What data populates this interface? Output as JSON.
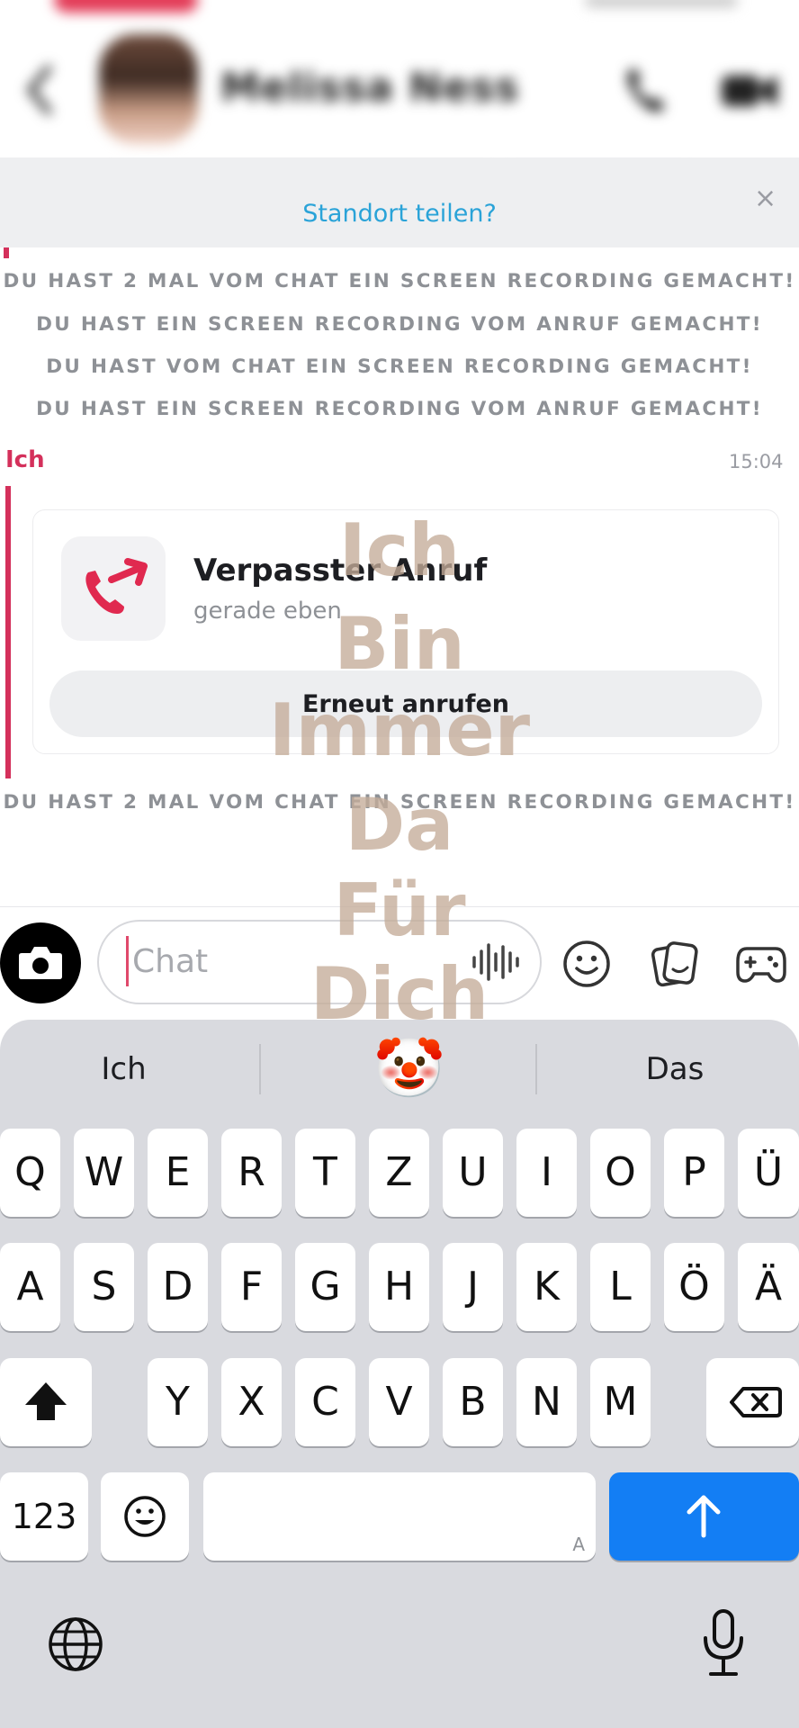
{
  "header": {
    "contact_name": "Melissa Ness",
    "info_text_blurred": "",
    "location_prompt": "Standort teilen?",
    "close_glyph": "×"
  },
  "messages": {
    "system_top": [
      "DU HAST 2 MAL VOM CHAT EIN SCREEN RECORDING GEMACHT!",
      "DU HAST EIN SCREEN RECORDING VOM ANRUF GEMACHT!",
      "DU HAST VOM CHAT EIN SCREEN RECORDING GEMACHT!",
      "DU HAST EIN SCREEN RECORDING VOM ANRUF GEMACHT!"
    ],
    "sender": "Ich",
    "time": "15:04",
    "call_card": {
      "title": "Verpasster Anruf",
      "subtitle": "gerade eben",
      "button_label": "Erneut anrufen"
    },
    "system_bottom": "DU HAST 2 MAL VOM CHAT EIN SCREEN RECORDING GEMACHT!"
  },
  "watermark_lines": [
    "Ich",
    "Bin",
    "Immer",
    "Da",
    "Für",
    "Dich"
  ],
  "input": {
    "placeholder": "Chat"
  },
  "keyboard": {
    "suggestions": [
      "Ich",
      "🤡",
      "Das"
    ],
    "row1": [
      "Q",
      "W",
      "E",
      "R",
      "T",
      "Z",
      "U",
      "I",
      "O",
      "P",
      "Ü"
    ],
    "row2": [
      "A",
      "S",
      "D",
      "F",
      "G",
      "H",
      "J",
      "K",
      "L",
      "Ö",
      "Ä"
    ],
    "row3": [
      "Y",
      "X",
      "C",
      "V",
      "B",
      "N",
      "M"
    ],
    "numbers_label": "123",
    "space_hint": "A",
    "emoji_glyph": "☺"
  },
  "colors": {
    "accent_pink": "#d4305b",
    "link_blue": "#2aa3d8",
    "send_blue": "#137ef4"
  }
}
